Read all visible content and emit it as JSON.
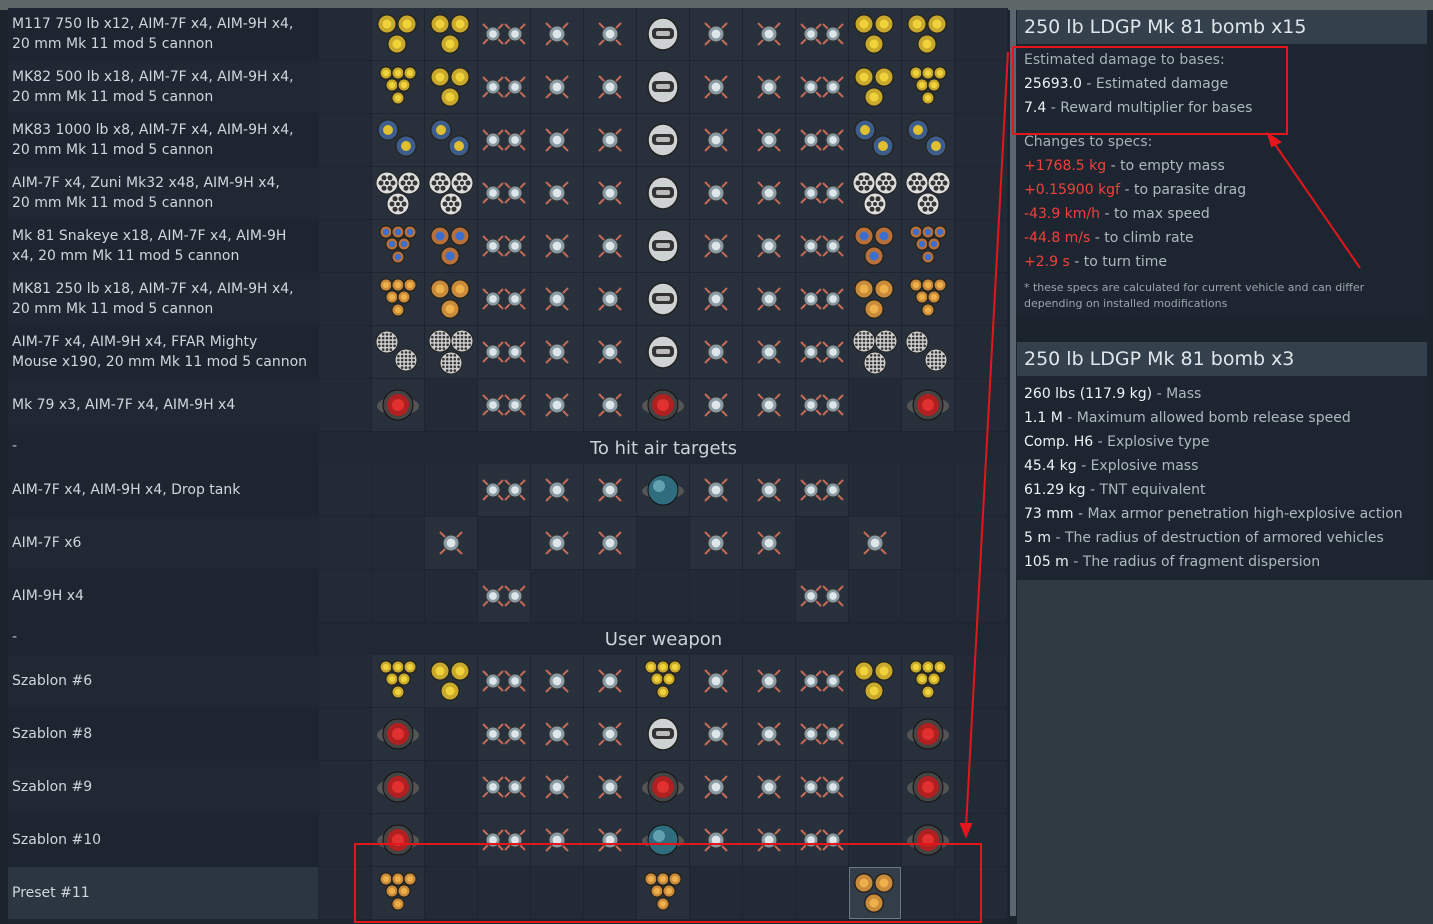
{
  "rows": [
    {
      "label": "M117 750 lb x12,  AIM-7F x4,  AIM-9H x4,\n20 mm Mk 11 mod 5 cannon",
      "cells": [
        "y3",
        "y3",
        "x2",
        "x",
        "x",
        "pod",
        "x",
        "x",
        "x2",
        "y3",
        "y3"
      ]
    },
    {
      "label": "MK82 500 lb x18,  AIM-7F x4,  AIM-9H x4,\n20 mm Mk 11 mod 5 cannon",
      "cells": [
        "y6",
        "y3",
        "x2",
        "x",
        "x",
        "pod",
        "x",
        "x",
        "x2",
        "y3",
        "y6"
      ]
    },
    {
      "label": "MK83 1000 lb x8,  AIM-7F x4,  AIM-9H x4,\n20 mm Mk 11 mod 5 cannon",
      "cells": [
        "b2",
        "b2",
        "x2",
        "x",
        "x",
        "pod",
        "x",
        "x",
        "x2",
        "b2",
        "b2"
      ]
    },
    {
      "label": "AIM-7F x4,  Zuni Mk32 x48,  AIM-9H x4,\n20 mm Mk 11 mod 5 cannon",
      "cells": [
        "z3",
        "z3",
        "x2",
        "x",
        "x",
        "pod",
        "x",
        "x",
        "x2",
        "z3",
        "z3"
      ]
    },
    {
      "label": "Mk 81 Snakeye x18,  AIM-7F x4,  AIM-9H\nx4,  20 mm Mk 11 mod 5 cannon",
      "cells": [
        "s6",
        "s3",
        "x2",
        "x",
        "x",
        "pod",
        "x",
        "x",
        "x2",
        "s3",
        "s6"
      ]
    },
    {
      "label": "MK81 250 lb x18,  AIM-7F x4,  AIM-9H x4,\n20 mm Mk 11 mod 5 cannon",
      "cells": [
        "o6",
        "o3",
        "x2",
        "x",
        "x",
        "pod",
        "x",
        "x",
        "x2",
        "o3",
        "o6"
      ]
    },
    {
      "label": "AIM-7F x4,  AIM-9H x4,  FFAR Mighty\nMouse x190,  20 mm Mk 11 mod 5 cannon",
      "cells": [
        "m2",
        "m3",
        "x2",
        "x",
        "x",
        "pod",
        "x",
        "x",
        "x2",
        "m3",
        "m2"
      ]
    },
    {
      "label": "Mk 79 x3,  AIM-7F x4,  AIM-9H x4",
      "cells": [
        "n",
        "",
        "x2",
        "x",
        "x",
        "n",
        "x",
        "x",
        "x2",
        "",
        "n"
      ]
    }
  ],
  "sep1": {
    "dash": "-",
    "title": "To hit air targets"
  },
  "rows2": [
    {
      "label": "AIM-7F x4,  AIM-9H x4,  Drop tank",
      "cells": [
        "",
        "",
        "x2",
        "x",
        "x",
        "t",
        "x",
        "x",
        "x2",
        "",
        ""
      ]
    },
    {
      "label": "AIM-7F x6",
      "cells": [
        "",
        "x",
        "",
        "x",
        "x",
        "",
        "x",
        "x",
        "",
        "x",
        ""
      ]
    },
    {
      "label": "AIM-9H x4",
      "cells": [
        "",
        "",
        "x2",
        "",
        "",
        "",
        "",
        "",
        "x2",
        "",
        ""
      ]
    }
  ],
  "sep2": {
    "dash": "-",
    "title": "User weapon"
  },
  "rows3": [
    {
      "label": "Szablon #6",
      "cells": [
        "y6",
        "y3",
        "x2",
        "x",
        "x",
        "y6",
        "x",
        "x",
        "x2",
        "y3",
        "y6"
      ]
    },
    {
      "label": "Szablon #8",
      "cells": [
        "n",
        "",
        "x2",
        "x",
        "x",
        "pod",
        "x",
        "x",
        "x2",
        "",
        "n"
      ]
    },
    {
      "label": "Szablon #9",
      "cells": [
        "n",
        "",
        "x2",
        "x",
        "x",
        "n",
        "x",
        "x",
        "x2",
        "",
        "n"
      ]
    },
    {
      "label": "Szablon #10",
      "cells": [
        "n",
        "",
        "x2",
        "x",
        "x",
        "t",
        "x",
        "x",
        "x2",
        "",
        "n"
      ]
    },
    {
      "label": "Preset #11",
      "cells": [
        "o6",
        "",
        "",
        "",
        "",
        "o6",
        "",
        "",
        "",
        "o3h",
        ""
      ]
    }
  ],
  "panel1": {
    "title": "250 lb LDGP Mk 81 bomb x15",
    "est_header": "Estimated damage to bases:",
    "est_damage_value": "25693.0",
    "est_damage_text": " - Estimated damage",
    "reward_value": "7.4",
    "reward_text": " - Reward multiplier for bases",
    "changes_header": "Changes to specs:",
    "changes": [
      {
        "value": "+1768.5 kg",
        "text": " - to empty mass"
      },
      {
        "value": "+0.15900 kgf",
        "text": " - to parasite drag"
      },
      {
        "value": "-43.9 km/h",
        "text": " - to max speed"
      },
      {
        "value": "-44.8 m/s",
        "text": " - to climb rate"
      },
      {
        "value": "+2.9 s",
        "text": " - to turn time"
      }
    ],
    "note": "* these specs are calculated for current vehicle and can differ\ndepending on installed modifications"
  },
  "panel2": {
    "title": "250 lb LDGP Mk 81 bomb x3",
    "specs": [
      {
        "value": "260 lbs (117.9 kg)",
        "text": " - Mass"
      },
      {
        "value": "1.1 M",
        "text": " - Maximum allowed bomb release speed"
      },
      {
        "value": "Comp. H6",
        "text": " - Explosive type"
      },
      {
        "value": "45.4 kg",
        "text": " - Explosive mass"
      },
      {
        "value": "61.29 kg",
        "text": " - TNT equivalent"
      },
      {
        "value": "73 mm",
        "text": " - Max armor penetration high-explosive action"
      },
      {
        "value": "5 m",
        "text": " - The radius of destruction of armored vehicles"
      },
      {
        "value": "105 m",
        "text": " - The radius of fragment dispersion"
      }
    ]
  },
  "colors": {
    "annotation": "#e3161c",
    "negative": "#f0413a",
    "accent": "#34404b"
  }
}
